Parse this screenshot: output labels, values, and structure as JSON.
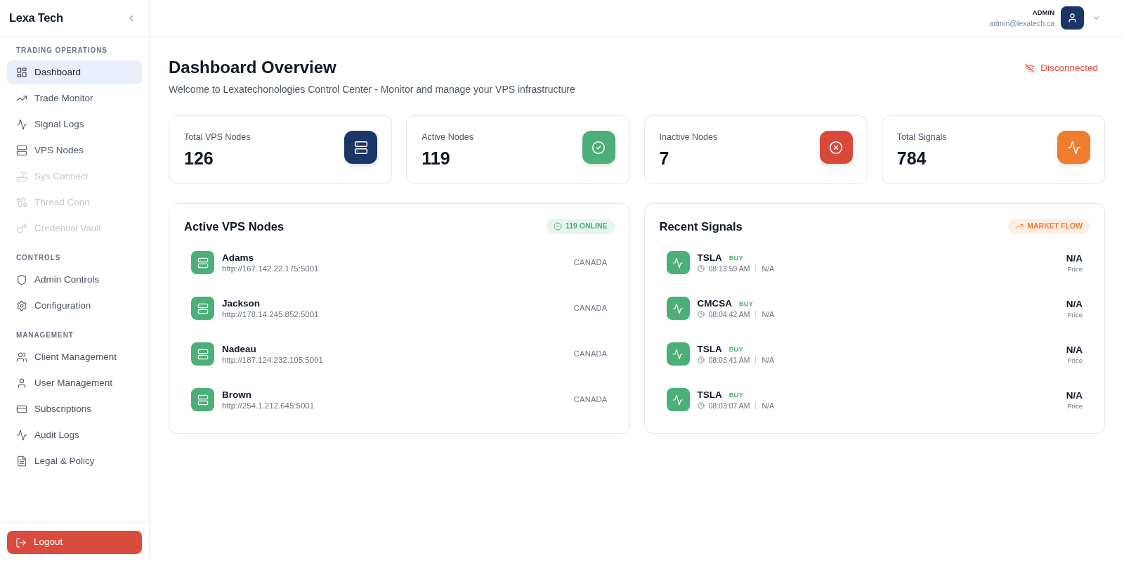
{
  "sidebar": {
    "brand": "Lexa Tech",
    "sections": [
      {
        "title": "TRADING OPERATIONS",
        "items": [
          {
            "label": "Dashboard",
            "selected": true,
            "disabled": false
          },
          {
            "label": "Trade Monitor",
            "selected": false,
            "disabled": false
          },
          {
            "label": "Signal Logs",
            "selected": false,
            "disabled": false
          },
          {
            "label": "VPS Nodes",
            "selected": false,
            "disabled": false
          },
          {
            "label": "Sys Connect",
            "selected": false,
            "disabled": true
          },
          {
            "label": "Thread Conn",
            "selected": false,
            "disabled": true
          },
          {
            "label": "Credential Vault",
            "selected": false,
            "disabled": true
          }
        ]
      },
      {
        "title": "CONTROLS",
        "items": [
          {
            "label": "Admin Controls",
            "selected": false,
            "disabled": false
          },
          {
            "label": "Configuration",
            "selected": false,
            "disabled": false
          }
        ]
      },
      {
        "title": "MANAGEMENT",
        "items": [
          {
            "label": "Client Management",
            "selected": false,
            "disabled": false
          },
          {
            "label": "User Management",
            "selected": false,
            "disabled": false
          },
          {
            "label": "Subscriptions",
            "selected": false,
            "disabled": false
          },
          {
            "label": "Audit Logs",
            "selected": false,
            "disabled": false
          },
          {
            "label": "Legal & Policy",
            "selected": false,
            "disabled": false
          }
        ]
      }
    ],
    "logout": "Logout"
  },
  "header": {
    "role": "ADMIN",
    "email": "admin@lexatech.ca"
  },
  "page": {
    "title": "Dashboard Overview",
    "subtitle": "Welcome to Lexatechonologies Control Center - Monitor and manage your VPS infrastructure",
    "connection": {
      "label": "Disconnected",
      "connected": false
    }
  },
  "stats": [
    {
      "label": "Total VPS Nodes",
      "value": "126",
      "color": "#1b3566"
    },
    {
      "label": "Active Nodes",
      "value": "119",
      "color": "#4caf78"
    },
    {
      "label": "Inactive Nodes",
      "value": "7",
      "color": "#d9493a"
    },
    {
      "label": "Total Signals",
      "value": "784",
      "color": "#f07c2d"
    }
  ],
  "nodes_panel": {
    "title": "Active VPS Nodes",
    "badge": "119 ONLINE",
    "rows": [
      {
        "name": "Adams",
        "url": "http://167.142.22.175:5001",
        "region": "CANADA"
      },
      {
        "name": "Jackson",
        "url": "http://178.14.245.852:5001",
        "region": "CANADA"
      },
      {
        "name": "Nadeau",
        "url": "http://187.124.232.105:5001",
        "region": "CANADA"
      },
      {
        "name": "Brown",
        "url": "http://254.1.212.645:5001",
        "region": "CANADA"
      }
    ]
  },
  "signals_panel": {
    "title": "Recent Signals",
    "badge": "MARKET FLOW",
    "rows": [
      {
        "symbol": "TSLA",
        "side": "BUY",
        "time": "08:13:59 AM",
        "detail": "N/A",
        "price": "N/A",
        "price_label": "Price"
      },
      {
        "symbol": "CMCSA",
        "side": "BUY",
        "time": "08:04:42 AM",
        "detail": "N/A",
        "price": "N/A",
        "price_label": "Price"
      },
      {
        "symbol": "TSLA",
        "side": "BUY",
        "time": "08:03:41 AM",
        "detail": "N/A",
        "price": "N/A",
        "price_label": "Price"
      },
      {
        "symbol": "TSLA",
        "side": "BUY",
        "time": "08:03:07 AM",
        "detail": "N/A",
        "price": "N/A",
        "price_label": "Price"
      }
    ]
  }
}
